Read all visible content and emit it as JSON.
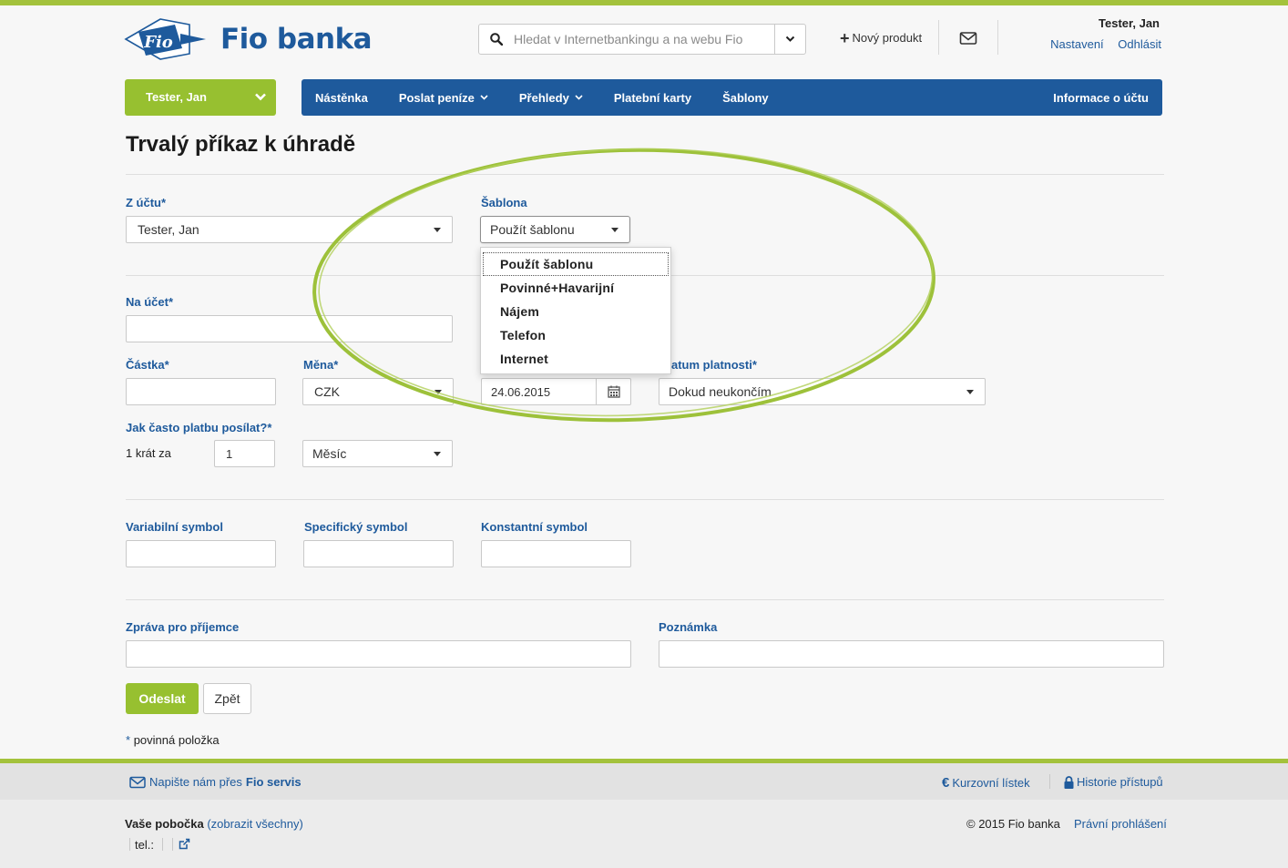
{
  "header": {
    "logo_text": "Fio banka",
    "logo_badge": "Fio",
    "search_placeholder": "Hledat v Internetbankingu a na webu Fio",
    "new_product": "Nový produkt",
    "user_name": "Tester, Jan",
    "settings": "Nastavení",
    "logout": "Odhlásit"
  },
  "nav": {
    "account": "Tester, Jan",
    "items": [
      "Nástěnka",
      "Poslat peníze",
      "Přehledy",
      "Platební karty",
      "Šablony"
    ],
    "right": "Informace o účtu"
  },
  "page": {
    "title": "Trvalý příkaz k úhradě"
  },
  "form": {
    "from_label": "Z účtu*",
    "from_value": "Tester, Jan",
    "template_label": "Šablona",
    "template_value": "Použít šablonu",
    "template_options": [
      "Použít šablonu",
      "Povinné+Havarijní",
      "Nájem",
      "Telefon",
      "Internet"
    ],
    "to_label": "Na účet*",
    "amount_label": "Částka*",
    "currency_label": "Měna*",
    "currency_value": "CZK",
    "validity_label": "atum platnosti*",
    "date_value": "24.06.2015",
    "validity_value": "Dokud neukončím",
    "frequency_label": "Jak často platbu posílat?*",
    "frequency_prefix": "1 krát za",
    "frequency_count": "1",
    "frequency_unit": "Měsíc",
    "vs_label": "Variabilní symbol",
    "ss_label": "Specifický symbol",
    "ks_label": "Konstantní symbol",
    "message_label": "Zpráva pro příjemce",
    "note_label": "Poznámka",
    "submit": "Odeslat",
    "back": "Zpět",
    "required_mark": "*",
    "required_note": "povinná položka"
  },
  "footer": {
    "contact_prefix": "Napište nám přes",
    "contact_service": "Fio servis",
    "rates": "Kurzovní lístek",
    "history": "Historie přístupů",
    "branch_label": "Vaše pobočka",
    "branch_link": "(zobrazit všechny)",
    "tel": "tel.:",
    "copyright": "© 2015 Fio banka",
    "legal": "Právní prohlášení"
  },
  "colors": {
    "brand_blue": "#1e5a9c",
    "brand_green": "#97c030",
    "highlight_ellipse": "#9dc13a"
  }
}
